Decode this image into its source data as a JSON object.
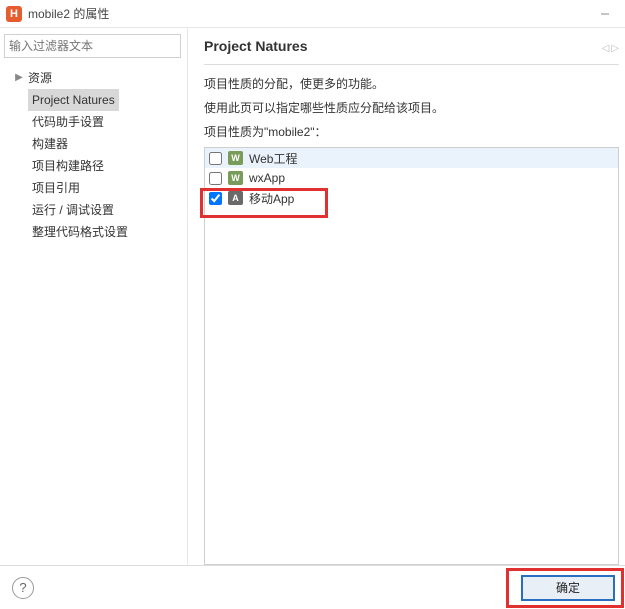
{
  "window": {
    "title": "mobile2 的属性",
    "app_icon_letter": "H"
  },
  "sidebar": {
    "filter_placeholder": "输入过滤器文本",
    "root_label": "资源",
    "items": [
      {
        "label": "Project Natures",
        "selected": true
      },
      {
        "label": "代码助手设置",
        "selected": false
      },
      {
        "label": "构建器",
        "selected": false
      },
      {
        "label": "项目构建路径",
        "selected": false
      },
      {
        "label": "项目引用",
        "selected": false
      },
      {
        "label": "运行 / 调试设置",
        "selected": false
      },
      {
        "label": "整理代码格式设置",
        "selected": false
      }
    ]
  },
  "main": {
    "heading": "Project Natures",
    "desc_line1": "项目性质的分配，使更多的功能。",
    "desc_line2": "使用此页可以指定哪些性质应分配给该项目。",
    "desc_line3": "项目性质为\"mobile2\"：",
    "natures": [
      {
        "label": "Web工程",
        "badge": "W",
        "badge_class": "badge-w",
        "checked": false,
        "hover": true
      },
      {
        "label": "wxApp",
        "badge": "W",
        "badge_class": "badge-w",
        "checked": false,
        "hover": false
      },
      {
        "label": "移动App",
        "badge": "A",
        "badge_class": "badge-a",
        "checked": true,
        "hover": false
      }
    ]
  },
  "footer": {
    "ok_label": "确定",
    "help_label": "?"
  }
}
